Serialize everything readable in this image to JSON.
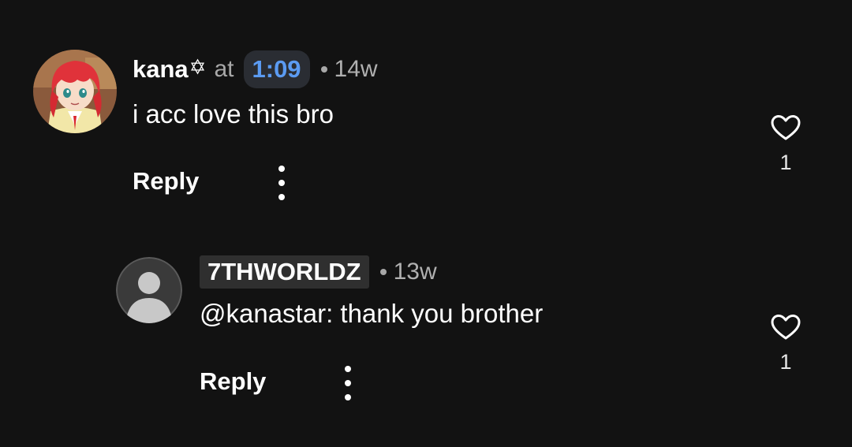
{
  "comments": [
    {
      "username": "kana",
      "username_star": "✡",
      "at_label": "at",
      "timestamp": "1:09",
      "age": "14w",
      "text": "i acc love this bro",
      "reply_label": "Reply",
      "likes": "1",
      "avatar_icon": "anime-avatar-icon"
    },
    {
      "username": "7THWORLDZ",
      "age": "13w",
      "text": "@kanastar: thank you brother",
      "reply_label": "Reply",
      "likes": "1",
      "avatar_icon": "default-user-icon"
    }
  ],
  "colors": {
    "background": "#121212",
    "timestamp_link": "#5b9bf2",
    "secondary_text": "#a8a8a8",
    "chip_background": "#2a2d33"
  }
}
